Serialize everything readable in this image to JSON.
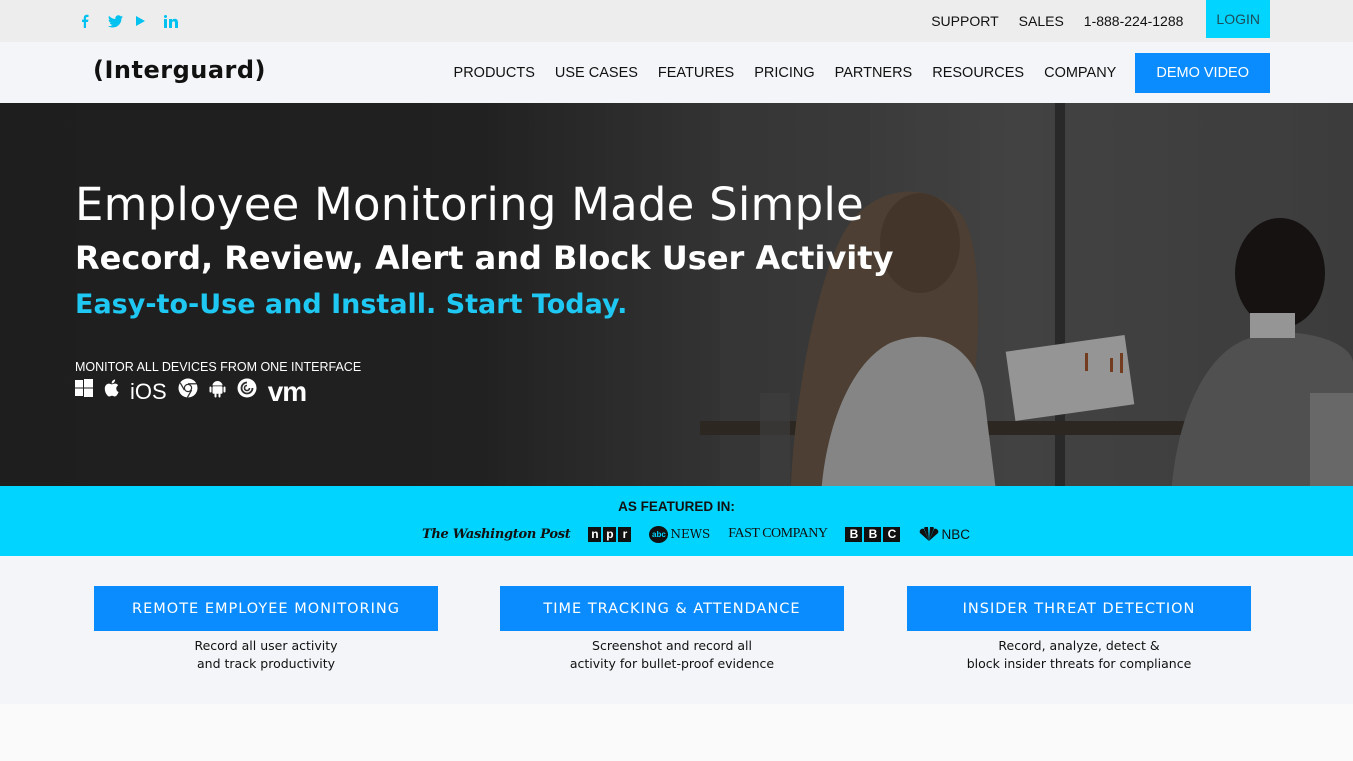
{
  "topbar": {
    "social": [
      {
        "name": "facebook",
        "icon": "facebook-icon"
      },
      {
        "name": "twitter",
        "icon": "twitter-icon"
      },
      {
        "name": "youtube",
        "icon": "youtube-play-icon"
      },
      {
        "name": "linkedin",
        "icon": "linkedin-icon"
      }
    ],
    "support_label": "SUPPORT",
    "sales_label": "SALES",
    "phone": "1-888-224-1288",
    "login_label": "LOGIN"
  },
  "navbar": {
    "logo": "(Interguard)",
    "items": [
      "PRODUCTS",
      "USE CASES",
      "FEATURES",
      "PRICING",
      "PARTNERS",
      "RESOURCES",
      "COMPANY"
    ],
    "demo_label": "DEMO VIDEO"
  },
  "hero": {
    "title": "Employee Monitoring Made Simple",
    "subtitle": "Record, Review, Alert and Block User Activity",
    "tagline": "Easy-to-Use and Install. Start Today.",
    "devices_label": "MONITOR ALL DEVICES FROM ONE INTERFACE",
    "devices": {
      "windows": "windows-icon",
      "apple": "apple-icon",
      "ios": "iOS",
      "chrome": "chrome-icon",
      "android": "android-icon",
      "chromebook": "chromebook-icon",
      "vm": "vm"
    }
  },
  "featured": {
    "label": "AS FEATURED IN:",
    "logos": {
      "wapo": "The Washington Post",
      "npr": [
        "n",
        "p",
        "r"
      ],
      "abc_circle": "abc",
      "abc_text": "NEWS",
      "fastco": "FAST COMPANY",
      "bbc": [
        "B",
        "B",
        "C"
      ],
      "nbc": "NBC"
    }
  },
  "features": [
    {
      "label": "REMOTE EMPLOYEE MONITORING",
      "line1": "Record all user activity",
      "line2": "and track productivity"
    },
    {
      "label": "TIME TRACKING & ATTENDANCE",
      "line1": "Screenshot and record all",
      "line2": "activity for bullet-proof evidence"
    },
    {
      "label": "INSIDER THREAT DETECTION",
      "line1": "Record, analyze, detect &",
      "line2": "block insider threats for compliance"
    }
  ],
  "colors": {
    "accent_cyan": "#00d4ff",
    "accent_blue": "#0a8cff",
    "tagline_cyan": "#1ec8f2"
  }
}
